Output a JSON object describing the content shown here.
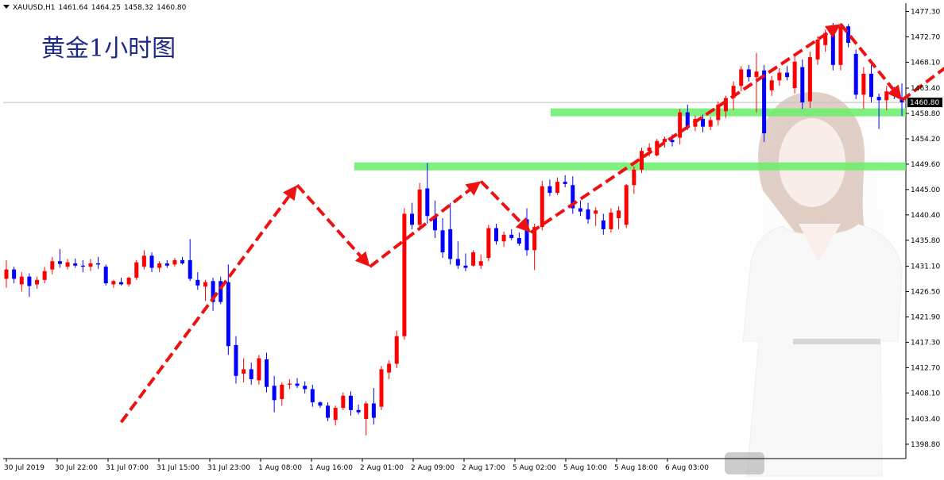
{
  "header": {
    "symbol": "XAUUSD,H1",
    "open": "1461.64",
    "high": "1464.25",
    "low": "1458.32",
    "close": "1460.80"
  },
  "title": "黄金1小时图",
  "chart_data": {
    "type": "candlestick",
    "y_axis": {
      "ylim": [
        1396.2,
        1478.8
      ],
      "ticks": [
        "1477.30",
        "1472.70",
        "1468.10",
        "1463.40",
        "1458.80",
        "1454.20",
        "1449.60",
        "1445.00",
        "1440.40",
        "1435.80",
        "1431.10",
        "1426.50",
        "1421.90",
        "1417.30",
        "1412.70",
        "1408.10",
        "1403.40",
        "1398.80"
      ]
    },
    "current_price": "1460.80",
    "x_tick_labels": [
      "30 Jul 2019",
      "30 Jul 22:00",
      "31 Jul 07:00",
      "31 Jul 15:00",
      "31 Jul 23:00",
      "1 Aug 08:00",
      "1 Aug 16:00",
      "2 Aug 01:00",
      "2 Aug 09:00",
      "2 Aug 17:00",
      "5 Aug 02:00",
      "5 Aug 10:00",
      "5 Aug 18:00",
      "6 Aug 03:00"
    ],
    "colors": {
      "bull": "#ff0000",
      "bear": "#0000ff",
      "support": "#66ee66",
      "arrow": "#ee1111",
      "price_line": "#c0c0c0"
    },
    "support_levels": [
      1459.0,
      1449.2
    ],
    "arrow_path": [
      {
        "x": 15.0,
        "y": 1402.8
      },
      {
        "x": 38.0,
        "y": 1445.8
      },
      {
        "x": 47.5,
        "y": 1431.0
      },
      {
        "x": 62.0,
        "y": 1446.5
      },
      {
        "x": 68.5,
        "y": 1437.2
      },
      {
        "x": 109.0,
        "y": 1475.0
      },
      {
        "x": 117.0,
        "y": 1461.2
      },
      {
        "x": 133.0,
        "y": 1477.8
      }
    ],
    "candles": [
      {
        "o": 1428.8,
        "h": 1432.2,
        "l": 1427.2,
        "c": 1430.5
      },
      {
        "o": 1430.5,
        "h": 1431.0,
        "l": 1428.0,
        "c": 1428.8
      },
      {
        "o": 1427.8,
        "h": 1430.0,
        "l": 1426.5,
        "c": 1429.2
      },
      {
        "o": 1429.2,
        "h": 1429.8,
        "l": 1425.5,
        "c": 1427.5
      },
      {
        "o": 1427.8,
        "h": 1429.2,
        "l": 1427.0,
        "c": 1428.6
      },
      {
        "o": 1428.6,
        "h": 1431.0,
        "l": 1428.0,
        "c": 1430.2
      },
      {
        "o": 1430.5,
        "h": 1432.8,
        "l": 1429.6,
        "c": 1432.0
      },
      {
        "o": 1432.0,
        "h": 1434.2,
        "l": 1430.8,
        "c": 1431.5
      },
      {
        "o": 1431.0,
        "h": 1432.4,
        "l": 1430.5,
        "c": 1431.8
      },
      {
        "o": 1431.6,
        "h": 1432.5,
        "l": 1430.8,
        "c": 1431.2
      },
      {
        "o": 1431.2,
        "h": 1432.2,
        "l": 1430.0,
        "c": 1431.0
      },
      {
        "o": 1431.0,
        "h": 1432.4,
        "l": 1430.2,
        "c": 1431.6
      },
      {
        "o": 1431.6,
        "h": 1432.8,
        "l": 1430.6,
        "c": 1431.4
      },
      {
        "o": 1431.0,
        "h": 1431.4,
        "l": 1427.6,
        "c": 1428.0
      },
      {
        "o": 1427.8,
        "h": 1428.6,
        "l": 1427.2,
        "c": 1428.4
      },
      {
        "o": 1428.2,
        "h": 1429.0,
        "l": 1427.6,
        "c": 1427.8
      },
      {
        "o": 1427.8,
        "h": 1429.2,
        "l": 1427.4,
        "c": 1429.0
      },
      {
        "o": 1429.0,
        "h": 1432.2,
        "l": 1428.6,
        "c": 1431.8
      },
      {
        "o": 1431.0,
        "h": 1434.0,
        "l": 1430.5,
        "c": 1433.0
      },
      {
        "o": 1433.0,
        "h": 1433.6,
        "l": 1430.0,
        "c": 1430.8
      },
      {
        "o": 1430.8,
        "h": 1432.0,
        "l": 1430.0,
        "c": 1431.6
      },
      {
        "o": 1431.6,
        "h": 1432.2,
        "l": 1430.8,
        "c": 1431.2
      },
      {
        "o": 1431.4,
        "h": 1432.6,
        "l": 1431.0,
        "c": 1432.2
      },
      {
        "o": 1432.2,
        "h": 1432.8,
        "l": 1431.4,
        "c": 1431.6
      },
      {
        "o": 1432.2,
        "h": 1436.0,
        "l": 1428.4,
        "c": 1428.8
      },
      {
        "o": 1428.6,
        "h": 1430.0,
        "l": 1426.8,
        "c": 1427.6
      },
      {
        "o": 1427.4,
        "h": 1428.6,
        "l": 1424.8,
        "c": 1428.2
      },
      {
        "o": 1428.4,
        "h": 1429.0,
        "l": 1423.0,
        "c": 1424.6
      },
      {
        "o": 1428.4,
        "h": 1429.2,
        "l": 1424.2,
        "c": 1424.6
      },
      {
        "o": 1428.2,
        "h": 1431.4,
        "l": 1415.0,
        "c": 1416.6
      },
      {
        "o": 1416.8,
        "h": 1418.4,
        "l": 1409.8,
        "c": 1411.2
      },
      {
        "o": 1411.6,
        "h": 1414.4,
        "l": 1410.0,
        "c": 1412.4
      },
      {
        "o": 1412.4,
        "h": 1413.6,
        "l": 1409.6,
        "c": 1410.6
      },
      {
        "o": 1410.4,
        "h": 1415.0,
        "l": 1409.6,
        "c": 1414.4
      },
      {
        "o": 1414.2,
        "h": 1415.4,
        "l": 1408.2,
        "c": 1409.2
      },
      {
        "o": 1409.4,
        "h": 1411.2,
        "l": 1404.6,
        "c": 1406.8
      },
      {
        "o": 1407.0,
        "h": 1410.0,
        "l": 1405.8,
        "c": 1409.6
      },
      {
        "o": 1409.6,
        "h": 1410.6,
        "l": 1408.8,
        "c": 1409.8
      },
      {
        "o": 1409.8,
        "h": 1410.8,
        "l": 1409.0,
        "c": 1409.4
      },
      {
        "o": 1409.4,
        "h": 1410.2,
        "l": 1408.0,
        "c": 1408.8
      },
      {
        "o": 1408.8,
        "h": 1409.6,
        "l": 1405.6,
        "c": 1406.4
      },
      {
        "o": 1406.4,
        "h": 1406.6,
        "l": 1405.4,
        "c": 1405.8
      },
      {
        "o": 1405.8,
        "h": 1406.4,
        "l": 1403.0,
        "c": 1403.6
      },
      {
        "o": 1403.2,
        "h": 1405.8,
        "l": 1402.2,
        "c": 1405.4
      },
      {
        "o": 1405.4,
        "h": 1408.2,
        "l": 1405.0,
        "c": 1407.6
      },
      {
        "o": 1407.6,
        "h": 1408.4,
        "l": 1404.0,
        "c": 1405.0
      },
      {
        "o": 1405.0,
        "h": 1406.0,
        "l": 1404.2,
        "c": 1404.6
      },
      {
        "o": 1403.4,
        "h": 1406.6,
        "l": 1400.4,
        "c": 1406.2
      },
      {
        "o": 1406.2,
        "h": 1409.0,
        "l": 1402.4,
        "c": 1403.6
      },
      {
        "o": 1405.6,
        "h": 1413.0,
        "l": 1405.0,
        "c": 1412.4
      },
      {
        "o": 1411.8,
        "h": 1414.0,
        "l": 1410.6,
        "c": 1413.4
      },
      {
        "o": 1413.4,
        "h": 1419.4,
        "l": 1412.6,
        "c": 1418.4
      },
      {
        "o": 1418.4,
        "h": 1441.6,
        "l": 1417.8,
        "c": 1440.6
      },
      {
        "o": 1440.6,
        "h": 1442.6,
        "l": 1437.8,
        "c": 1438.6
      },
      {
        "o": 1438.6,
        "h": 1446.2,
        "l": 1437.6,
        "c": 1445.0
      },
      {
        "o": 1445.2,
        "h": 1449.8,
        "l": 1438.8,
        "c": 1440.2
      },
      {
        "o": 1440.2,
        "h": 1443.0,
        "l": 1436.2,
        "c": 1437.6
      },
      {
        "o": 1437.6,
        "h": 1439.8,
        "l": 1432.6,
        "c": 1433.6
      },
      {
        "o": 1437.8,
        "h": 1442.6,
        "l": 1431.4,
        "c": 1432.4
      },
      {
        "o": 1432.4,
        "h": 1435.6,
        "l": 1430.6,
        "c": 1431.2
      },
      {
        "o": 1431.2,
        "h": 1433.4,
        "l": 1430.2,
        "c": 1430.8
      },
      {
        "o": 1431.2,
        "h": 1434.0,
        "l": 1431.0,
        "c": 1433.6
      },
      {
        "o": 1431.2,
        "h": 1433.2,
        "l": 1430.6,
        "c": 1432.0
      },
      {
        "o": 1432.6,
        "h": 1438.6,
        "l": 1432.0,
        "c": 1438.0
      },
      {
        "o": 1438.0,
        "h": 1438.8,
        "l": 1435.0,
        "c": 1435.6
      },
      {
        "o": 1435.6,
        "h": 1437.4,
        "l": 1434.6,
        "c": 1436.8
      },
      {
        "o": 1436.8,
        "h": 1437.8,
        "l": 1435.8,
        "c": 1436.2
      },
      {
        "o": 1436.2,
        "h": 1437.2,
        "l": 1434.8,
        "c": 1435.2
      },
      {
        "o": 1439.6,
        "h": 1441.6,
        "l": 1433.0,
        "c": 1434.0
      },
      {
        "o": 1434.0,
        "h": 1438.8,
        "l": 1430.4,
        "c": 1438.2
      },
      {
        "o": 1438.2,
        "h": 1446.6,
        "l": 1437.6,
        "c": 1445.6
      },
      {
        "o": 1445.6,
        "h": 1446.8,
        "l": 1443.8,
        "c": 1444.4
      },
      {
        "o": 1444.4,
        "h": 1447.2,
        "l": 1444.0,
        "c": 1446.4
      },
      {
        "o": 1446.4,
        "h": 1447.6,
        "l": 1445.4,
        "c": 1446.0
      },
      {
        "o": 1445.8,
        "h": 1447.4,
        "l": 1440.6,
        "c": 1441.6
      },
      {
        "o": 1441.6,
        "h": 1443.0,
        "l": 1440.2,
        "c": 1441.0
      },
      {
        "o": 1441.4,
        "h": 1442.6,
        "l": 1438.8,
        "c": 1439.6
      },
      {
        "o": 1440.6,
        "h": 1441.8,
        "l": 1438.4,
        "c": 1441.2
      },
      {
        "o": 1439.4,
        "h": 1440.6,
        "l": 1436.8,
        "c": 1437.8
      },
      {
        "o": 1437.8,
        "h": 1441.6,
        "l": 1437.2,
        "c": 1440.8
      },
      {
        "o": 1439.8,
        "h": 1442.0,
        "l": 1437.8,
        "c": 1441.2
      },
      {
        "o": 1438.6,
        "h": 1446.0,
        "l": 1438.0,
        "c": 1445.8
      },
      {
        "o": 1445.8,
        "h": 1449.2,
        "l": 1444.2,
        "c": 1448.6
      },
      {
        "o": 1448.6,
        "h": 1452.6,
        "l": 1448.0,
        "c": 1452.0
      },
      {
        "o": 1452.0,
        "h": 1453.4,
        "l": 1451.0,
        "c": 1452.6
      },
      {
        "o": 1451.2,
        "h": 1454.2,
        "l": 1451.0,
        "c": 1453.8
      },
      {
        "o": 1453.6,
        "h": 1454.6,
        "l": 1452.6,
        "c": 1454.2
      },
      {
        "o": 1454.0,
        "h": 1455.0,
        "l": 1452.8,
        "c": 1453.6
      },
      {
        "o": 1454.4,
        "h": 1459.6,
        "l": 1453.2,
        "c": 1459.0
      },
      {
        "o": 1459.0,
        "h": 1460.4,
        "l": 1455.8,
        "c": 1456.4
      },
      {
        "o": 1456.4,
        "h": 1458.4,
        "l": 1455.6,
        "c": 1457.8
      },
      {
        "o": 1457.8,
        "h": 1458.6,
        "l": 1455.4,
        "c": 1456.4
      },
      {
        "o": 1456.4,
        "h": 1458.2,
        "l": 1455.8,
        "c": 1457.6
      },
      {
        "o": 1457.6,
        "h": 1461.0,
        "l": 1456.6,
        "c": 1460.4
      },
      {
        "o": 1459.2,
        "h": 1462.0,
        "l": 1458.0,
        "c": 1461.6
      },
      {
        "o": 1461.6,
        "h": 1464.6,
        "l": 1459.4,
        "c": 1463.8
      },
      {
        "o": 1463.8,
        "h": 1467.4,
        "l": 1462.8,
        "c": 1466.8
      },
      {
        "o": 1466.8,
        "h": 1467.6,
        "l": 1464.6,
        "c": 1465.4
      },
      {
        "o": 1465.4,
        "h": 1469.8,
        "l": 1459.0,
        "c": 1466.4
      },
      {
        "o": 1466.6,
        "h": 1467.6,
        "l": 1453.6,
        "c": 1455.2
      },
      {
        "o": 1463.0,
        "h": 1465.6,
        "l": 1462.0,
        "c": 1464.8
      },
      {
        "o": 1464.8,
        "h": 1467.0,
        "l": 1463.8,
        "c": 1466.2
      },
      {
        "o": 1466.2,
        "h": 1467.4,
        "l": 1464.8,
        "c": 1465.4
      },
      {
        "o": 1463.4,
        "h": 1469.2,
        "l": 1462.4,
        "c": 1468.2
      },
      {
        "o": 1467.2,
        "h": 1468.6,
        "l": 1459.6,
        "c": 1460.8
      },
      {
        "o": 1461.0,
        "h": 1470.0,
        "l": 1459.8,
        "c": 1469.0
      },
      {
        "o": 1468.6,
        "h": 1472.8,
        "l": 1467.6,
        "c": 1472.2
      },
      {
        "o": 1471.2,
        "h": 1474.0,
        "l": 1470.0,
        "c": 1473.4
      },
      {
        "o": 1473.4,
        "h": 1475.2,
        "l": 1466.6,
        "c": 1467.6
      },
      {
        "o": 1467.6,
        "h": 1475.2,
        "l": 1466.6,
        "c": 1474.6
      },
      {
        "o": 1474.6,
        "h": 1475.0,
        "l": 1470.8,
        "c": 1471.6
      },
      {
        "o": 1469.6,
        "h": 1470.4,
        "l": 1461.4,
        "c": 1462.2
      },
      {
        "o": 1462.2,
        "h": 1467.2,
        "l": 1459.6,
        "c": 1466.0
      },
      {
        "o": 1466.0,
        "h": 1467.6,
        "l": 1460.8,
        "c": 1461.8
      },
      {
        "o": 1461.8,
        "h": 1462.4,
        "l": 1456.0,
        "c": 1461.2
      },
      {
        "o": 1461.2,
        "h": 1463.8,
        "l": 1459.4,
        "c": 1462.8
      },
      {
        "o": 1462.6,
        "h": 1463.6,
        "l": 1461.4,
        "c": 1462.2
      },
      {
        "o": 1461.64,
        "h": 1464.25,
        "l": 1458.32,
        "c": 1460.8
      }
    ]
  }
}
